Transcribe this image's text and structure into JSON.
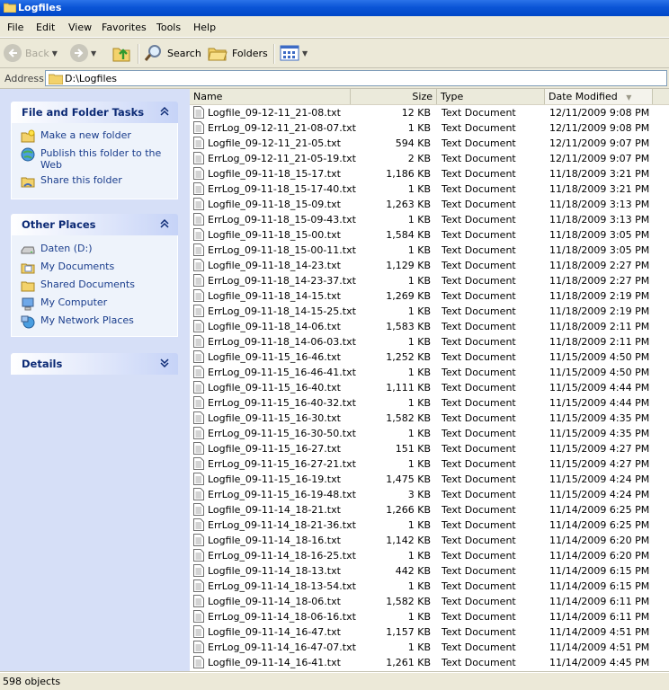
{
  "window": {
    "title": "Logfiles"
  },
  "menu": [
    "File",
    "Edit",
    "View",
    "Favorites",
    "Tools",
    "Help"
  ],
  "toolbar": {
    "back_label": "Back",
    "search_label": "Search",
    "folders_label": "Folders"
  },
  "address": {
    "label": "Address",
    "value": "D:\\Logfiles"
  },
  "tasks": {
    "file_folder": {
      "title": "File and Folder Tasks",
      "items": [
        "Make a new folder",
        "Publish this folder to the Web",
        "Share this folder"
      ]
    },
    "other_places": {
      "title": "Other Places",
      "items": [
        "Daten (D:)",
        "My Documents",
        "Shared Documents",
        "My Computer",
        "My Network Places"
      ]
    },
    "details": {
      "title": "Details"
    }
  },
  "columns": {
    "name": "Name",
    "size": "Size",
    "type": "Type",
    "date": "Date Modified"
  },
  "files": [
    {
      "name": "Logfile_09-12-11_21-08.txt",
      "size": "12 KB",
      "type": "Text Document",
      "date": "12/11/2009 9:08 PM"
    },
    {
      "name": "ErrLog_09-12-11_21-08-07.txt",
      "size": "1 KB",
      "type": "Text Document",
      "date": "12/11/2009 9:08 PM"
    },
    {
      "name": "Logfile_09-12-11_21-05.txt",
      "size": "594 KB",
      "type": "Text Document",
      "date": "12/11/2009 9:07 PM"
    },
    {
      "name": "ErrLog_09-12-11_21-05-19.txt",
      "size": "2 KB",
      "type": "Text Document",
      "date": "12/11/2009 9:07 PM"
    },
    {
      "name": "Logfile_09-11-18_15-17.txt",
      "size": "1,186 KB",
      "type": "Text Document",
      "date": "11/18/2009 3:21 PM"
    },
    {
      "name": "ErrLog_09-11-18_15-17-40.txt",
      "size": "1 KB",
      "type": "Text Document",
      "date": "11/18/2009 3:21 PM"
    },
    {
      "name": "Logfile_09-11-18_15-09.txt",
      "size": "1,263 KB",
      "type": "Text Document",
      "date": "11/18/2009 3:13 PM"
    },
    {
      "name": "ErrLog_09-11-18_15-09-43.txt",
      "size": "1 KB",
      "type": "Text Document",
      "date": "11/18/2009 3:13 PM"
    },
    {
      "name": "Logfile_09-11-18_15-00.txt",
      "size": "1,584 KB",
      "type": "Text Document",
      "date": "11/18/2009 3:05 PM"
    },
    {
      "name": "ErrLog_09-11-18_15-00-11.txt",
      "size": "1 KB",
      "type": "Text Document",
      "date": "11/18/2009 3:05 PM"
    },
    {
      "name": "Logfile_09-11-18_14-23.txt",
      "size": "1,129 KB",
      "type": "Text Document",
      "date": "11/18/2009 2:27 PM"
    },
    {
      "name": "ErrLog_09-11-18_14-23-37.txt",
      "size": "1 KB",
      "type": "Text Document",
      "date": "11/18/2009 2:27 PM"
    },
    {
      "name": "Logfile_09-11-18_14-15.txt",
      "size": "1,269 KB",
      "type": "Text Document",
      "date": "11/18/2009 2:19 PM"
    },
    {
      "name": "ErrLog_09-11-18_14-15-25.txt",
      "size": "1 KB",
      "type": "Text Document",
      "date": "11/18/2009 2:19 PM"
    },
    {
      "name": "Logfile_09-11-18_14-06.txt",
      "size": "1,583 KB",
      "type": "Text Document",
      "date": "11/18/2009 2:11 PM"
    },
    {
      "name": "ErrLog_09-11-18_14-06-03.txt",
      "size": "1 KB",
      "type": "Text Document",
      "date": "11/18/2009 2:11 PM"
    },
    {
      "name": "Logfile_09-11-15_16-46.txt",
      "size": "1,252 KB",
      "type": "Text Document",
      "date": "11/15/2009 4:50 PM"
    },
    {
      "name": "ErrLog_09-11-15_16-46-41.txt",
      "size": "1 KB",
      "type": "Text Document",
      "date": "11/15/2009 4:50 PM"
    },
    {
      "name": "Logfile_09-11-15_16-40.txt",
      "size": "1,111 KB",
      "type": "Text Document",
      "date": "11/15/2009 4:44 PM"
    },
    {
      "name": "ErrLog_09-11-15_16-40-32.txt",
      "size": "1 KB",
      "type": "Text Document",
      "date": "11/15/2009 4:44 PM"
    },
    {
      "name": "Logfile_09-11-15_16-30.txt",
      "size": "1,582 KB",
      "type": "Text Document",
      "date": "11/15/2009 4:35 PM"
    },
    {
      "name": "ErrLog_09-11-15_16-30-50.txt",
      "size": "1 KB",
      "type": "Text Document",
      "date": "11/15/2009 4:35 PM"
    },
    {
      "name": "Logfile_09-11-15_16-27.txt",
      "size": "151 KB",
      "type": "Text Document",
      "date": "11/15/2009 4:27 PM"
    },
    {
      "name": "ErrLog_09-11-15_16-27-21.txt",
      "size": "1 KB",
      "type": "Text Document",
      "date": "11/15/2009 4:27 PM"
    },
    {
      "name": "Logfile_09-11-15_16-19.txt",
      "size": "1,475 KB",
      "type": "Text Document",
      "date": "11/15/2009 4:24 PM"
    },
    {
      "name": "ErrLog_09-11-15_16-19-48.txt",
      "size": "3 KB",
      "type": "Text Document",
      "date": "11/15/2009 4:24 PM"
    },
    {
      "name": "Logfile_09-11-14_18-21.txt",
      "size": "1,266 KB",
      "type": "Text Document",
      "date": "11/14/2009 6:25 PM"
    },
    {
      "name": "ErrLog_09-11-14_18-21-36.txt",
      "size": "1 KB",
      "type": "Text Document",
      "date": "11/14/2009 6:25 PM"
    },
    {
      "name": "Logfile_09-11-14_18-16.txt",
      "size": "1,142 KB",
      "type": "Text Document",
      "date": "11/14/2009 6:20 PM"
    },
    {
      "name": "ErrLog_09-11-14_18-16-25.txt",
      "size": "1 KB",
      "type": "Text Document",
      "date": "11/14/2009 6:20 PM"
    },
    {
      "name": "Logfile_09-11-14_18-13.txt",
      "size": "442 KB",
      "type": "Text Document",
      "date": "11/14/2009 6:15 PM"
    },
    {
      "name": "ErrLog_09-11-14_18-13-54.txt",
      "size": "1 KB",
      "type": "Text Document",
      "date": "11/14/2009 6:15 PM"
    },
    {
      "name": "Logfile_09-11-14_18-06.txt",
      "size": "1,582 KB",
      "type": "Text Document",
      "date": "11/14/2009 6:11 PM"
    },
    {
      "name": "ErrLog_09-11-14_18-06-16.txt",
      "size": "1 KB",
      "type": "Text Document",
      "date": "11/14/2009 6:11 PM"
    },
    {
      "name": "Logfile_09-11-14_16-47.txt",
      "size": "1,157 KB",
      "type": "Text Document",
      "date": "11/14/2009 4:51 PM"
    },
    {
      "name": "ErrLog_09-11-14_16-47-07.txt",
      "size": "1 KB",
      "type": "Text Document",
      "date": "11/14/2009 4:51 PM"
    },
    {
      "name": "Logfile_09-11-14_16-41.txt",
      "size": "1,261 KB",
      "type": "Text Document",
      "date": "11/14/2009 4:45 PM"
    }
  ],
  "status": {
    "text": "598 objects"
  },
  "icons": {
    "title": "folder-icon",
    "back": "back-arrow-icon",
    "forward": "forward-arrow-icon",
    "up": "up-folder-icon",
    "search": "search-icon",
    "folders": "folders-icon",
    "views": "views-icon",
    "file": "text-file-icon"
  },
  "colors": {
    "title_bar": "#0b55d6",
    "task_pane": "#d6dff7",
    "chrome": "#ece9d8",
    "task_text": "#1a3d8c"
  }
}
